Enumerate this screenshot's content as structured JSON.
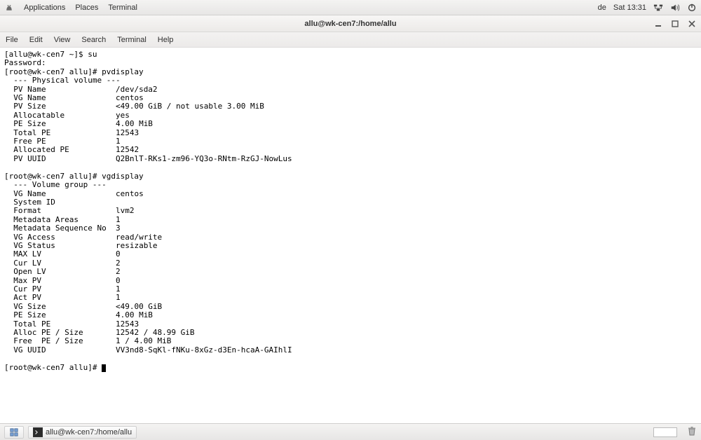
{
  "topbar": {
    "applications": "Applications",
    "places": "Places",
    "terminal": "Terminal",
    "lang": "de",
    "clock": "Sat 13:31"
  },
  "window": {
    "title": "allu@wk-cen7:/home/allu"
  },
  "menubar": {
    "file": "File",
    "edit": "Edit",
    "view": "View",
    "search": "Search",
    "terminal": "Terminal",
    "help": "Help"
  },
  "terminal": {
    "prompt_user": "[allu@wk-cen7 ~]$ ",
    "cmd_su": "su",
    "password_label": "Password:",
    "prompt_root1": "[root@wk-cen7 allu]# ",
    "cmd_pv": "pvdisplay",
    "pv_header": "  --- Physical volume ---",
    "pv": {
      "name_l": "  PV Name               ",
      "name_v": "/dev/sda2",
      "vg_l": "  VG Name               ",
      "vg_v": "centos",
      "size_l": "  PV Size               ",
      "size_v": "<49.00 GiB / not usable 3.00 MiB",
      "alloc_l": "  Allocatable           ",
      "alloc_v": "yes",
      "pesz_l": "  PE Size               ",
      "pesz_v": "4.00 MiB",
      "tpe_l": "  Total PE              ",
      "tpe_v": "12543",
      "fpe_l": "  Free PE               ",
      "fpe_v": "1",
      "ape_l": "  Allocated PE          ",
      "ape_v": "12542",
      "uuid_l": "  PV UUID               ",
      "uuid_v": "Q2BnlT-RKs1-zm96-YQ3o-RNtm-RzGJ-NowLus"
    },
    "cmd_vg": "vgdisplay",
    "vg_header": "  --- Volume group ---",
    "vg": {
      "name_l": "  VG Name               ",
      "name_v": "centos",
      "sys_l": "  System ID             ",
      "sys_v": "",
      "fmt_l": "  Format                ",
      "fmt_v": "lvm2",
      "ma_l": "  Metadata Areas        ",
      "ma_v": "1",
      "ms_l": "  Metadata Sequence No  ",
      "ms_v": "3",
      "acc_l": "  VG Access             ",
      "acc_v": "read/write",
      "stat_l": "  VG Status             ",
      "stat_v": "resizable",
      "maxlv_l": "  MAX LV                ",
      "maxlv_v": "0",
      "curlv_l": "  Cur LV                ",
      "curlv_v": "2",
      "oplv_l": "  Open LV               ",
      "oplv_v": "2",
      "maxpv_l": "  Max PV                ",
      "maxpv_v": "0",
      "curpv_l": "  Cur PV                ",
      "curpv_v": "1",
      "actpv_l": "  Act PV                ",
      "actpv_v": "1",
      "vgsz_l": "  VG Size               ",
      "vgsz_v": "<49.00 GiB",
      "pesz_l": "  PE Size               ",
      "pesz_v": "4.00 MiB",
      "tpe_l": "  Total PE              ",
      "tpe_v": "12543",
      "ape_l": "  Alloc PE / Size       ",
      "ape_v": "12542 / 48.99 GiB",
      "fpe_l": "  Free  PE / Size       ",
      "fpe_v": "1 / 4.00 MiB",
      "uuid_l": "  VG UUID               ",
      "uuid_v": "VV3nd8-SqKl-fNKu-8xGz-d3En-hcaA-GAIhlI"
    },
    "prompt_root2": "[root@wk-cen7 allu]# "
  },
  "taskbar": {
    "task1": "allu@wk-cen7:/home/allu"
  }
}
